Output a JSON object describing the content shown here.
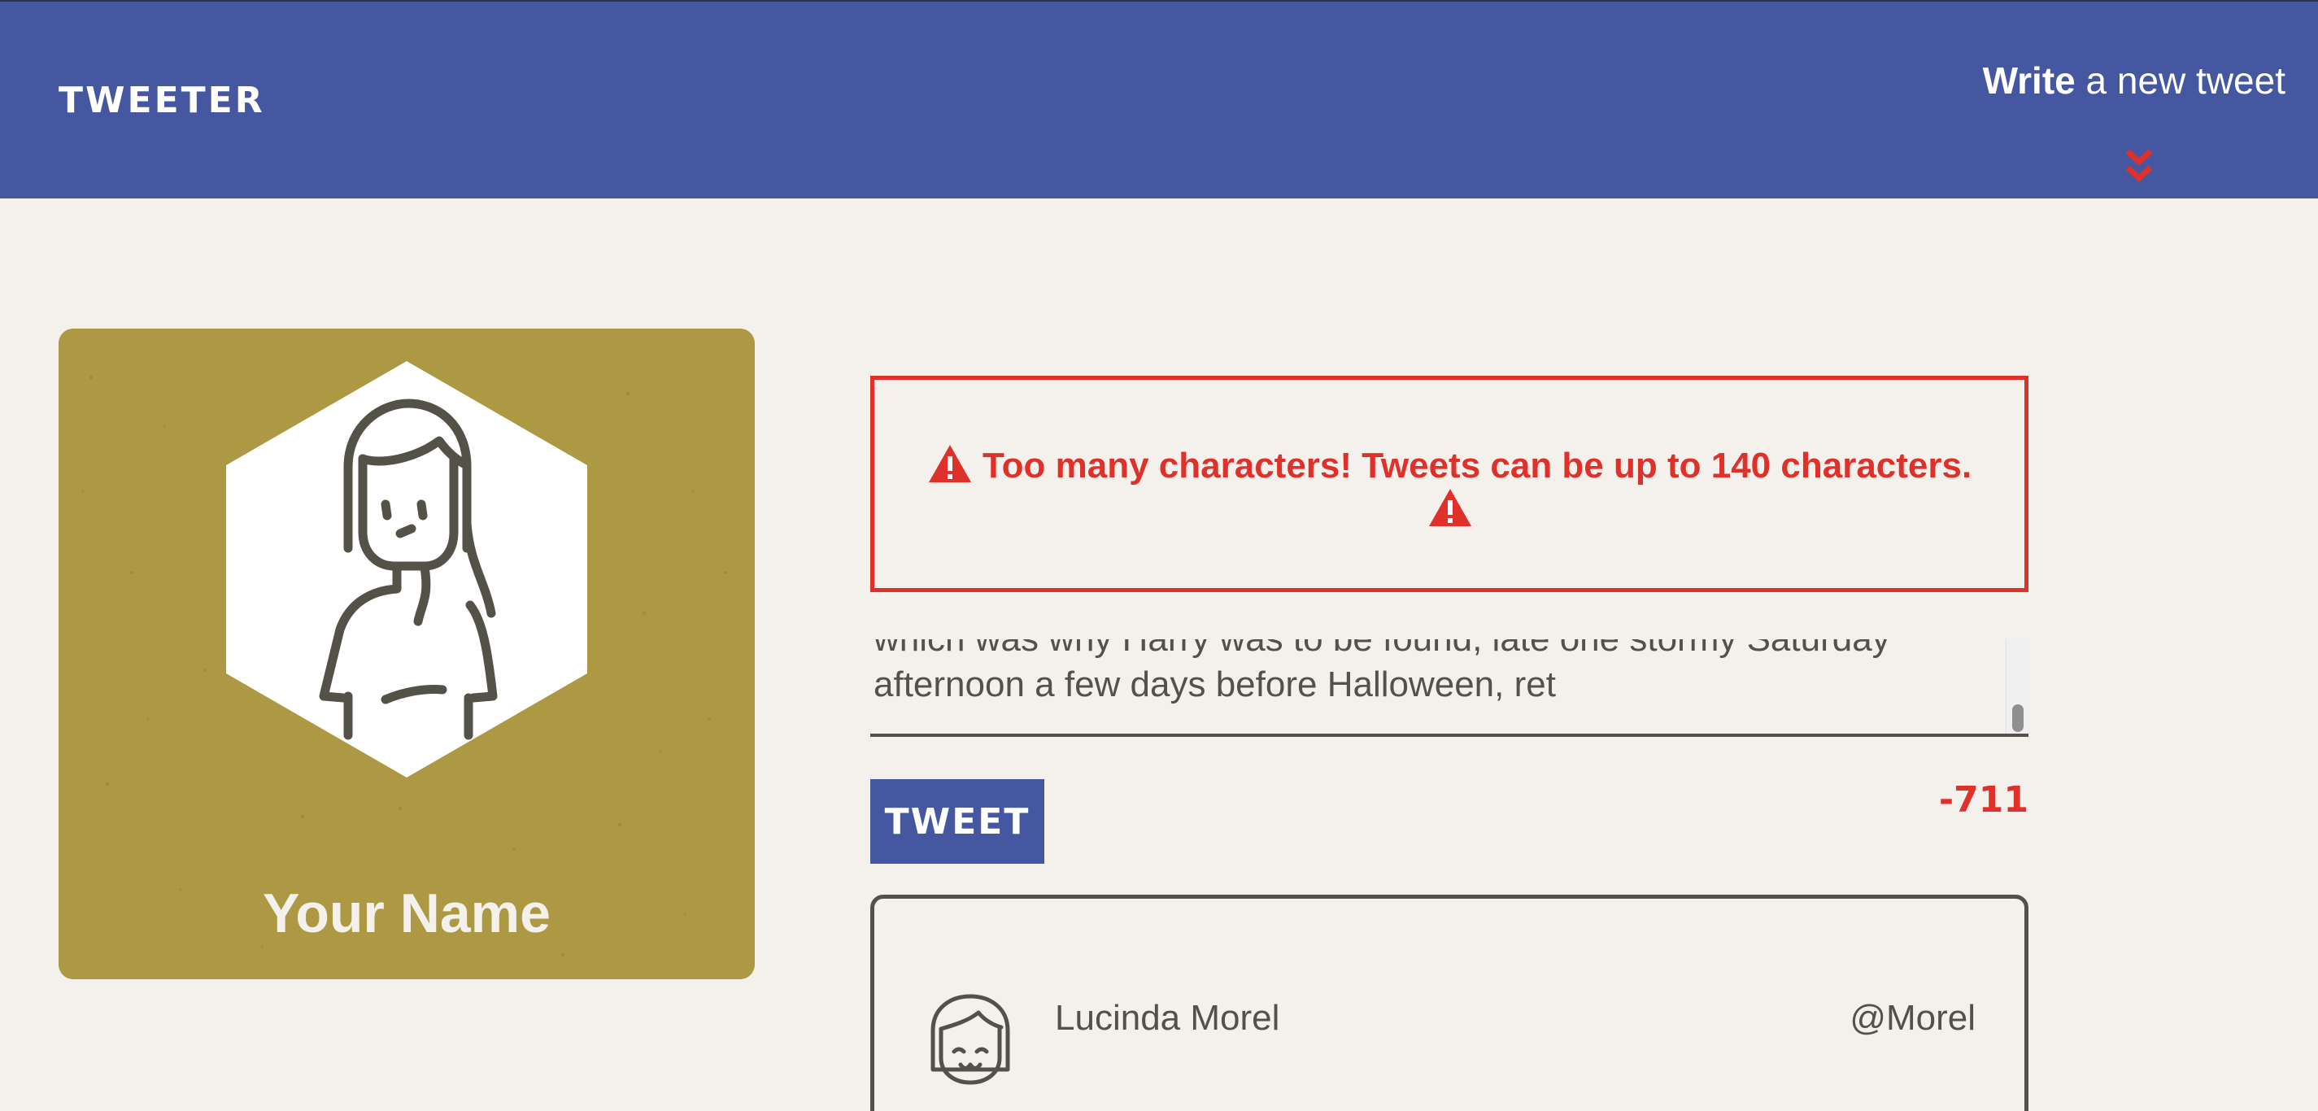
{
  "nav": {
    "brand": "TWEETER",
    "compose_bold": "Write",
    "compose_rest": " a new tweet",
    "chevron_icon": "double-chevron-down-icon",
    "background_color": "#4557a0",
    "accent_color": "#e0302a"
  },
  "profile": {
    "name": "Your Name",
    "card_color": "#ad9843",
    "avatar_icon": "user-avatar-icon"
  },
  "compose": {
    "error_message": "Too many characters! Tweets can be up to 140 characters.",
    "error_icon": "warning-icon",
    "textarea_value": "which was why Harry was to be found, late one stormy Saturday\nafternoon a few days before Halloween, ret",
    "tweet_button_label": "TWEET",
    "counter": "-711"
  },
  "tweets": [
    {
      "name": "Lucinda Morel",
      "handle": "@Morel",
      "avatar_icon": "user-avatar-icon"
    }
  ]
}
